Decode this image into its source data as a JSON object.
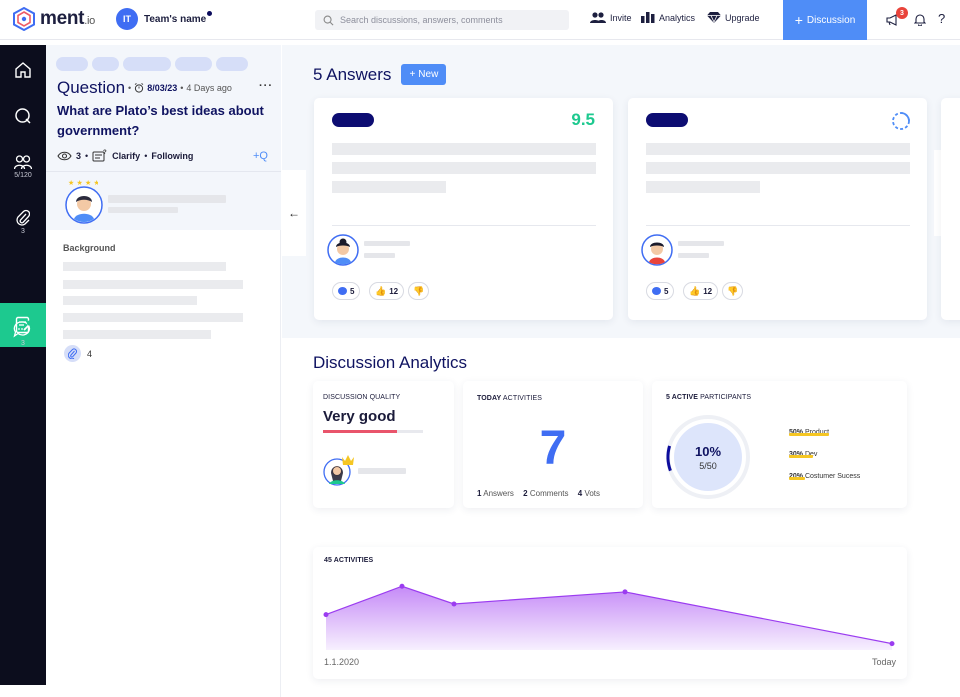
{
  "topbar": {
    "brand": "ment",
    "brand_suffix": ".io",
    "team_initials": "IT",
    "team_name": "Team's name",
    "search_placeholder": "Search discussions, answers, comments",
    "invite_label": "Invite",
    "analytics_label": "Analytics",
    "upgrade_label": "Upgrade",
    "discussion_label": "Discussion",
    "notification_count": "3",
    "help_label": "?"
  },
  "rail": {
    "members_count": "5/120",
    "attachments_count": "3",
    "messages_count": "3"
  },
  "question": {
    "heading": "Question",
    "date": "8/03/23",
    "age": "4 Days ago",
    "title": "What are Plato’s best ideas about government?",
    "views": "3",
    "clarify_label": "Clarify",
    "following_label": "Following",
    "add_q_label": "+Q",
    "background_label": "Background",
    "attachments": "4"
  },
  "answers": {
    "heading": "5 Answers",
    "new_label": "New",
    "cards": [
      {
        "score": "9.5",
        "comments": "5",
        "likes": "12"
      },
      {
        "score": "",
        "comments": "5",
        "likes": "12"
      }
    ]
  },
  "analytics": {
    "heading": "Discussion Analytics",
    "quality_label": "DISCUSSION QUALITY",
    "quality_value": "Very good",
    "quality_fill": 0.74,
    "today_bold": "TODAY",
    "today_rest": "ACTIVITIES",
    "today_value": "7",
    "answers_count": "1",
    "answers_label": "Answers",
    "comments_count": "2",
    "comments_label": "Comments",
    "votes_count": "4",
    "votes_label": "Vots",
    "participants_bold": "5 ACTIVE",
    "participants_rest": "PARTICIPANTS",
    "ring_percent": "10%",
    "ring_fraction": "5/50",
    "ring_fill": 0.1,
    "breakdown": [
      {
        "pct": "50%",
        "name": "Product",
        "fill": 0.5
      },
      {
        "pct": "30%",
        "name": "Dev",
        "fill": 0.3
      },
      {
        "pct": "20%",
        "name": "Costumer Sucess",
        "fill": 0.2
      }
    ]
  },
  "activity": {
    "title": "45 ACTIVITIES",
    "x_start": "1.1.2020",
    "x_end": "Today"
  },
  "chart_data": {
    "type": "area",
    "title": "45 ACTIVITIES",
    "x_labels": [
      "1.1.2020",
      "Today"
    ],
    "series": [
      {
        "values": [
          5,
          9,
          6.5,
          8.2,
          0.9
        ]
      }
    ],
    "ylim": [
      0,
      12
    ],
    "grid": false,
    "colors": {
      "line": "#9b3cf0",
      "fill_top": "#c58af7",
      "fill_bottom": "#f7f0fe"
    }
  },
  "colors": {
    "accent": "#4f8df7",
    "active": "#1dc98f",
    "navy": "#0d0d72",
    "score": "#1dc98f",
    "quality_bar": "#e9546b"
  }
}
